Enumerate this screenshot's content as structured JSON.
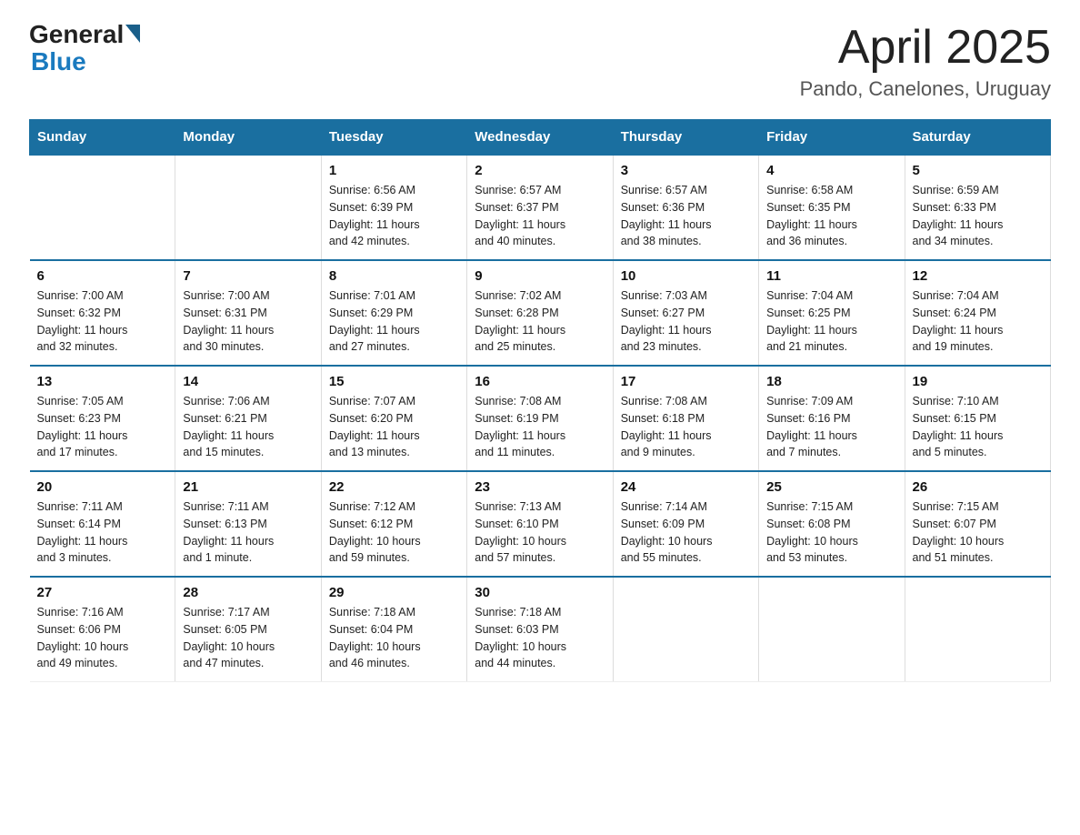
{
  "header": {
    "logo_general": "General",
    "logo_blue": "Blue",
    "month_title": "April 2025",
    "location": "Pando, Canelones, Uruguay"
  },
  "days_of_week": [
    "Sunday",
    "Monday",
    "Tuesday",
    "Wednesday",
    "Thursday",
    "Friday",
    "Saturday"
  ],
  "weeks": [
    [
      {
        "day": "",
        "sunrise": "",
        "sunset": "",
        "daylight": ""
      },
      {
        "day": "",
        "sunrise": "",
        "sunset": "",
        "daylight": ""
      },
      {
        "day": "1",
        "sunrise": "Sunrise: 6:56 AM",
        "sunset": "Sunset: 6:39 PM",
        "daylight": "Daylight: 11 hours and 42 minutes."
      },
      {
        "day": "2",
        "sunrise": "Sunrise: 6:57 AM",
        "sunset": "Sunset: 6:37 PM",
        "daylight": "Daylight: 11 hours and 40 minutes."
      },
      {
        "day": "3",
        "sunrise": "Sunrise: 6:57 AM",
        "sunset": "Sunset: 6:36 PM",
        "daylight": "Daylight: 11 hours and 38 minutes."
      },
      {
        "day": "4",
        "sunrise": "Sunrise: 6:58 AM",
        "sunset": "Sunset: 6:35 PM",
        "daylight": "Daylight: 11 hours and 36 minutes."
      },
      {
        "day": "5",
        "sunrise": "Sunrise: 6:59 AM",
        "sunset": "Sunset: 6:33 PM",
        "daylight": "Daylight: 11 hours and 34 minutes."
      }
    ],
    [
      {
        "day": "6",
        "sunrise": "Sunrise: 7:00 AM",
        "sunset": "Sunset: 6:32 PM",
        "daylight": "Daylight: 11 hours and 32 minutes."
      },
      {
        "day": "7",
        "sunrise": "Sunrise: 7:00 AM",
        "sunset": "Sunset: 6:31 PM",
        "daylight": "Daylight: 11 hours and 30 minutes."
      },
      {
        "day": "8",
        "sunrise": "Sunrise: 7:01 AM",
        "sunset": "Sunset: 6:29 PM",
        "daylight": "Daylight: 11 hours and 27 minutes."
      },
      {
        "day": "9",
        "sunrise": "Sunrise: 7:02 AM",
        "sunset": "Sunset: 6:28 PM",
        "daylight": "Daylight: 11 hours and 25 minutes."
      },
      {
        "day": "10",
        "sunrise": "Sunrise: 7:03 AM",
        "sunset": "Sunset: 6:27 PM",
        "daylight": "Daylight: 11 hours and 23 minutes."
      },
      {
        "day": "11",
        "sunrise": "Sunrise: 7:04 AM",
        "sunset": "Sunset: 6:25 PM",
        "daylight": "Daylight: 11 hours and 21 minutes."
      },
      {
        "day": "12",
        "sunrise": "Sunrise: 7:04 AM",
        "sunset": "Sunset: 6:24 PM",
        "daylight": "Daylight: 11 hours and 19 minutes."
      }
    ],
    [
      {
        "day": "13",
        "sunrise": "Sunrise: 7:05 AM",
        "sunset": "Sunset: 6:23 PM",
        "daylight": "Daylight: 11 hours and 17 minutes."
      },
      {
        "day": "14",
        "sunrise": "Sunrise: 7:06 AM",
        "sunset": "Sunset: 6:21 PM",
        "daylight": "Daylight: 11 hours and 15 minutes."
      },
      {
        "day": "15",
        "sunrise": "Sunrise: 7:07 AM",
        "sunset": "Sunset: 6:20 PM",
        "daylight": "Daylight: 11 hours and 13 minutes."
      },
      {
        "day": "16",
        "sunrise": "Sunrise: 7:08 AM",
        "sunset": "Sunset: 6:19 PM",
        "daylight": "Daylight: 11 hours and 11 minutes."
      },
      {
        "day": "17",
        "sunrise": "Sunrise: 7:08 AM",
        "sunset": "Sunset: 6:18 PM",
        "daylight": "Daylight: 11 hours and 9 minutes."
      },
      {
        "day": "18",
        "sunrise": "Sunrise: 7:09 AM",
        "sunset": "Sunset: 6:16 PM",
        "daylight": "Daylight: 11 hours and 7 minutes."
      },
      {
        "day": "19",
        "sunrise": "Sunrise: 7:10 AM",
        "sunset": "Sunset: 6:15 PM",
        "daylight": "Daylight: 11 hours and 5 minutes."
      }
    ],
    [
      {
        "day": "20",
        "sunrise": "Sunrise: 7:11 AM",
        "sunset": "Sunset: 6:14 PM",
        "daylight": "Daylight: 11 hours and 3 minutes."
      },
      {
        "day": "21",
        "sunrise": "Sunrise: 7:11 AM",
        "sunset": "Sunset: 6:13 PM",
        "daylight": "Daylight: 11 hours and 1 minute."
      },
      {
        "day": "22",
        "sunrise": "Sunrise: 7:12 AM",
        "sunset": "Sunset: 6:12 PM",
        "daylight": "Daylight: 10 hours and 59 minutes."
      },
      {
        "day": "23",
        "sunrise": "Sunrise: 7:13 AM",
        "sunset": "Sunset: 6:10 PM",
        "daylight": "Daylight: 10 hours and 57 minutes."
      },
      {
        "day": "24",
        "sunrise": "Sunrise: 7:14 AM",
        "sunset": "Sunset: 6:09 PM",
        "daylight": "Daylight: 10 hours and 55 minutes."
      },
      {
        "day": "25",
        "sunrise": "Sunrise: 7:15 AM",
        "sunset": "Sunset: 6:08 PM",
        "daylight": "Daylight: 10 hours and 53 minutes."
      },
      {
        "day": "26",
        "sunrise": "Sunrise: 7:15 AM",
        "sunset": "Sunset: 6:07 PM",
        "daylight": "Daylight: 10 hours and 51 minutes."
      }
    ],
    [
      {
        "day": "27",
        "sunrise": "Sunrise: 7:16 AM",
        "sunset": "Sunset: 6:06 PM",
        "daylight": "Daylight: 10 hours and 49 minutes."
      },
      {
        "day": "28",
        "sunrise": "Sunrise: 7:17 AM",
        "sunset": "Sunset: 6:05 PM",
        "daylight": "Daylight: 10 hours and 47 minutes."
      },
      {
        "day": "29",
        "sunrise": "Sunrise: 7:18 AM",
        "sunset": "Sunset: 6:04 PM",
        "daylight": "Daylight: 10 hours and 46 minutes."
      },
      {
        "day": "30",
        "sunrise": "Sunrise: 7:18 AM",
        "sunset": "Sunset: 6:03 PM",
        "daylight": "Daylight: 10 hours and 44 minutes."
      },
      {
        "day": "",
        "sunrise": "",
        "sunset": "",
        "daylight": ""
      },
      {
        "day": "",
        "sunrise": "",
        "sunset": "",
        "daylight": ""
      },
      {
        "day": "",
        "sunrise": "",
        "sunset": "",
        "daylight": ""
      }
    ]
  ]
}
